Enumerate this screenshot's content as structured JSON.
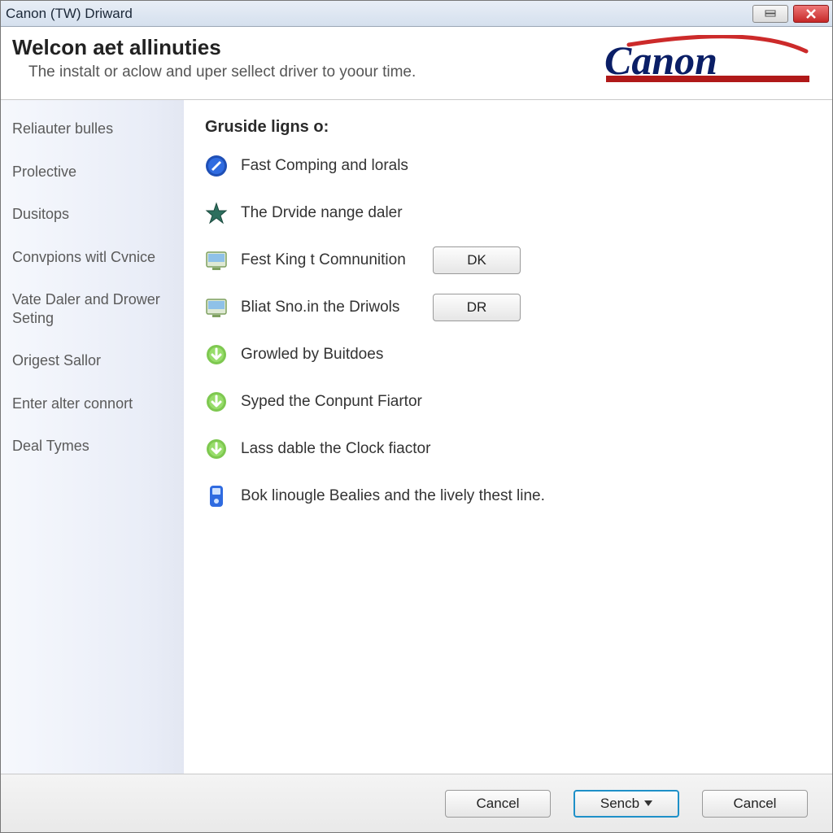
{
  "titlebar": {
    "title": "Canon (TW) Driward"
  },
  "header": {
    "title": "Welcon aet allinuties",
    "subtitle": "The instalt or aclow and uper sellect driver to yoour time.",
    "logo_text": "Canon"
  },
  "sidebar": {
    "items": [
      "Reliauter bulles",
      "Prolective",
      "Dusitops",
      "Convpions witl Cvnice",
      "Vate Daler and Drower Seting",
      "Origest Sallor",
      "Enter alter connort",
      "Deal Tymes"
    ]
  },
  "main": {
    "heading": "Gruside ligns o:",
    "items": [
      {
        "icon": "wrench-circle",
        "label": "Fast Comping and lorals",
        "button": null
      },
      {
        "icon": "star",
        "label": "The Drvide nange daler",
        "button": null
      },
      {
        "icon": "monitor",
        "label": "Fest King t Comnunition",
        "button": "DK"
      },
      {
        "icon": "monitor",
        "label": "Bliat Sno.in the Driwols",
        "button": "DR"
      },
      {
        "icon": "arrow-down-green",
        "label": "Growled by Buitdoes",
        "button": null
      },
      {
        "icon": "arrow-down-green",
        "label": "Syped the Conpunt Fiartor",
        "button": null
      },
      {
        "icon": "arrow-down-green",
        "label": "Lass dable the Clock fiactor",
        "button": null
      },
      {
        "icon": "device-blue",
        "label": "Bok linougle Bealies and the lively thest line.",
        "button": null
      }
    ]
  },
  "footer": {
    "cancel_left": "Cancel",
    "primary": "Sencb",
    "cancel_right": "Cancel"
  }
}
